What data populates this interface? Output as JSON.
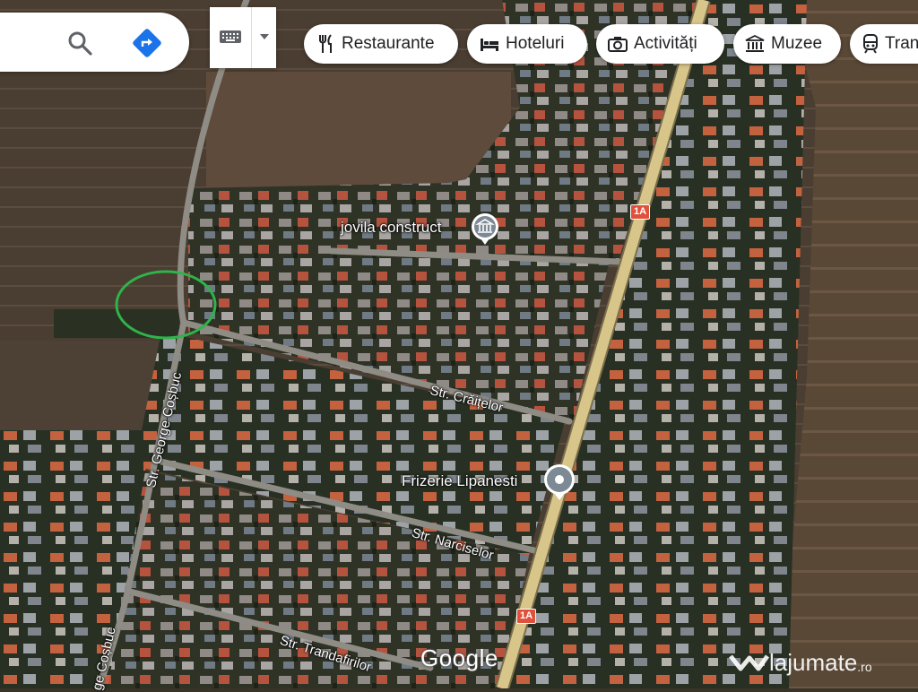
{
  "search": {
    "search_icon": "search-icon",
    "directions_icon": "directions-icon"
  },
  "keyboard": {
    "icon": "keyboard-icon",
    "dropdown_icon": "caret-down-icon"
  },
  "chips": [
    {
      "label": "Restaurante",
      "icon": "fork-knife-icon"
    },
    {
      "label": "Hoteluri",
      "icon": "bed-icon"
    },
    {
      "label": "Activități",
      "icon": "camera-icon"
    },
    {
      "label": "Muzee",
      "icon": "museum-icon"
    },
    {
      "label": "Tran",
      "icon": "train-icon"
    }
  ],
  "places": {
    "jovila": "jovila construct",
    "frizerie": "Frizerie Lipanesti"
  },
  "streets": {
    "craitelor": "Str. Crăițelor",
    "george_cosbuc": "Str. George Coșbuc",
    "george_cosbuc_lower": "ge Coșbuc",
    "narciselor": "Str. Narciselor",
    "trandafirilor": "Str. Trandafirilor"
  },
  "road_shields": {
    "top": "1A",
    "bottom": "1A"
  },
  "branding": {
    "google": "Google",
    "watermark": "lajumate",
    "watermark_tld": ".ro"
  },
  "colors": {
    "highlight_circle": "#2fb34a",
    "road_main": "#d8c58a",
    "shield": "#e0513b"
  }
}
